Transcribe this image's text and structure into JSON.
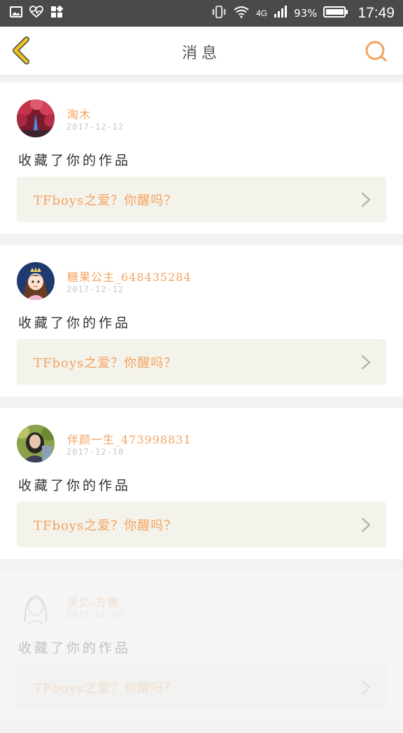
{
  "status_bar": {
    "network": "4G",
    "battery": "93%",
    "time": "17:49",
    "icons": [
      "image-icon",
      "heart-monitor-icon",
      "apps-icon",
      "vibrate-icon",
      "wifi-icon",
      "signal-icon",
      "battery-icon"
    ]
  },
  "header": {
    "title": "消息",
    "back_icon": "chevron-left-icon",
    "search_icon": "search-icon",
    "accent_color": "#f0c419",
    "search_color": "#f4a25e"
  },
  "messages": [
    {
      "username": "淘木",
      "date": "2017-12-12",
      "action": "收藏了你的作品",
      "work_title": "TFboys之爱？你醒吗？",
      "avatar": "avatar-red-trees-icon"
    },
    {
      "username": "糖果公主_648435284",
      "date": "2017-12-12",
      "action": "收藏了你的作品",
      "work_title": "TFboys之爱？你醒吗？",
      "avatar": "avatar-princess-icon"
    },
    {
      "username": "伴颜一生_473998831",
      "date": "2017-12-10",
      "action": "收藏了你的作品",
      "work_title": "TFboys之爱？你醒吗？",
      "avatar": "avatar-girl-photo-icon"
    },
    {
      "username": "灵忆-方晚",
      "date": "2017-12-08",
      "action": "收藏了你的作品",
      "work_title": "TFboys之爱？你醒吗？",
      "avatar": "avatar-sketch-girl-icon"
    }
  ],
  "colors": {
    "username": "#f4a25e",
    "work_link_bg": "#f3f3eb",
    "status_bar_bg": "#4a4a4a"
  }
}
